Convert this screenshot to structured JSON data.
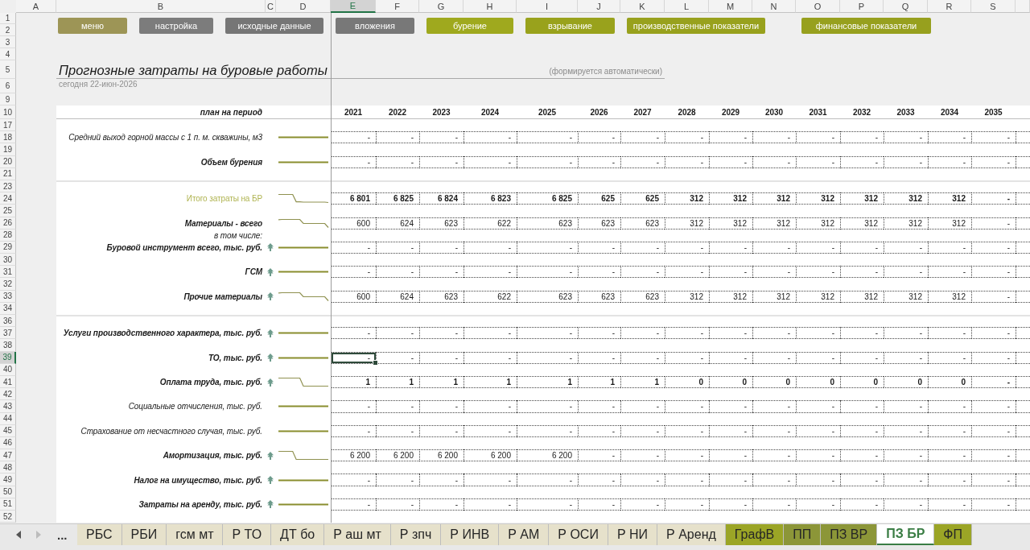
{
  "sheet": {
    "columns": [
      {
        "label": "A",
        "selected": false
      },
      {
        "label": "B",
        "selected": false
      },
      {
        "label": "C",
        "selected": false
      },
      {
        "label": "D",
        "selected": false
      },
      {
        "label": "E",
        "selected": true
      },
      {
        "label": "F",
        "selected": false
      },
      {
        "label": "G",
        "selected": false
      },
      {
        "label": "H",
        "selected": false
      },
      {
        "label": "I",
        "selected": false
      },
      {
        "label": "J",
        "selected": false
      },
      {
        "label": "K",
        "selected": false
      },
      {
        "label": "L",
        "selected": false
      },
      {
        "label": "M",
        "selected": false
      },
      {
        "label": "N",
        "selected": false
      },
      {
        "label": "O",
        "selected": false
      },
      {
        "label": "P",
        "selected": false
      },
      {
        "label": "Q",
        "selected": false
      },
      {
        "label": "R",
        "selected": false
      },
      {
        "label": "S",
        "selected": false
      }
    ],
    "rows": [
      {
        "number": "1",
        "selected": false,
        "kind": "buttons",
        "buttons": [
          {
            "label": "меню",
            "color": "#9d9556"
          },
          {
            "label": "настройка",
            "color": "#7c7c7c"
          },
          {
            "label": "исходные данные",
            "color": "#767676"
          },
          {
            "label": "вложения",
            "color": "#787878"
          },
          {
            "label": "бурение",
            "color": "#9fa91e"
          },
          {
            "label": "взрывание",
            "color": "#99a21c"
          },
          {
            "label": "производственные показатели",
            "color": "#98a11d"
          },
          {
            "label": "финансовые показатели",
            "color": "#97a01e"
          }
        ]
      },
      {
        "number": "2",
        "selected": false,
        "kind": "spacer"
      },
      {
        "number": "3",
        "selected": false,
        "kind": "spacer"
      },
      {
        "number": "4",
        "selected": false,
        "kind": "spacer"
      },
      {
        "number": "5",
        "selected": false,
        "kind": "title",
        "title": "Прогнозные затраты на буровые работы",
        "note": "(формируется автоматически)"
      },
      {
        "number": "6",
        "selected": false,
        "kind": "date",
        "text": "сегодня 22-июн-2026"
      },
      {
        "number": "9",
        "selected": false,
        "kind": "spacer"
      },
      {
        "number": "10",
        "selected": false,
        "kind": "header",
        "label": "план на период",
        "years": [
          "2021",
          "2022",
          "2023",
          "2024",
          "2025",
          "2026",
          "2027",
          "2028",
          "2029",
          "2030",
          "2031",
          "2032",
          "2033",
          "2034",
          "2035"
        ]
      },
      {
        "number": "17",
        "selected": false,
        "kind": "blank"
      },
      {
        "number": "18",
        "selected": false,
        "kind": "line",
        "label": "Средний выход горной массы с 1 п. м. скважины, м3",
        "bold": false,
        "italic": true,
        "accent": false,
        "arrow": false,
        "bold_values": false,
        "values": [
          "-",
          "-",
          "-",
          "-",
          "-",
          "-",
          "-",
          "-",
          "-",
          "-",
          "-",
          "-",
          "-",
          "-",
          "-"
        ]
      },
      {
        "number": "19",
        "selected": false,
        "kind": "blank"
      },
      {
        "number": "20",
        "selected": false,
        "kind": "line",
        "label": "Объем бурения",
        "bold": true,
        "italic": true,
        "accent": false,
        "arrow": false,
        "bold_values": false,
        "values": [
          "-",
          "-",
          "-",
          "-",
          "-",
          "-",
          "-",
          "-",
          "-",
          "-",
          "-",
          "-",
          "-",
          "-",
          "-"
        ]
      },
      {
        "number": "21",
        "selected": false,
        "kind": "blank"
      },
      {
        "number": "23",
        "selected": false,
        "kind": "section"
      },
      {
        "number": "24",
        "selected": false,
        "kind": "line",
        "label": "Итого затраты на БР",
        "bold": false,
        "italic": false,
        "accent": true,
        "arrow": false,
        "bold_values": true,
        "values": [
          "6 801",
          "6 825",
          "6 824",
          "6 823",
          "6 825",
          "625",
          "625",
          "312",
          "312",
          "312",
          "312",
          "312",
          "312",
          "312",
          "-"
        ]
      },
      {
        "number": "25",
        "selected": false,
        "kind": "blank"
      },
      {
        "number": "26",
        "selected": false,
        "kind": "line",
        "label": "Материалы - всего",
        "bold": true,
        "italic": true,
        "accent": false,
        "arrow": false,
        "bold_values": false,
        "values": [
          "600",
          "624",
          "623",
          "622",
          "623",
          "623",
          "623",
          "312",
          "312",
          "312",
          "312",
          "312",
          "312",
          "312",
          "-"
        ]
      },
      {
        "number": "28",
        "selected": false,
        "kind": "note",
        "label": "в том числе:",
        "bold": false,
        "italic": true,
        "accent": false
      },
      {
        "number": "29",
        "selected": false,
        "kind": "line",
        "label": "Буровой инструмент всего, тыс. руб.",
        "bold": true,
        "italic": true,
        "accent": false,
        "arrow": true,
        "bold_values": false,
        "values": [
          "-",
          "-",
          "-",
          "-",
          "-",
          "-",
          "-",
          "-",
          "-",
          "-",
          "-",
          "-",
          "-",
          "-",
          "-"
        ]
      },
      {
        "number": "30",
        "selected": false,
        "kind": "blank"
      },
      {
        "number": "31",
        "selected": false,
        "kind": "line",
        "label": "ГСМ",
        "bold": true,
        "italic": true,
        "accent": false,
        "arrow": true,
        "bold_values": false,
        "values": [
          "-",
          "-",
          "-",
          "-",
          "-",
          "-",
          "-",
          "-",
          "-",
          "-",
          "-",
          "-",
          "-",
          "-",
          "-"
        ]
      },
      {
        "number": "32",
        "selected": false,
        "kind": "blank"
      },
      {
        "number": "33",
        "selected": false,
        "kind": "line",
        "label": "Прочие материалы",
        "bold": true,
        "italic": true,
        "accent": false,
        "arrow": true,
        "bold_values": false,
        "values": [
          "600",
          "624",
          "623",
          "622",
          "623",
          "623",
          "623",
          "312",
          "312",
          "312",
          "312",
          "312",
          "312",
          "312",
          "-"
        ]
      },
      {
        "number": "34",
        "selected": false,
        "kind": "blank"
      },
      {
        "number": "36",
        "selected": false,
        "kind": "section"
      },
      {
        "number": "37",
        "selected": false,
        "kind": "line",
        "label": "Услуги производственного характера, тыс. руб.",
        "bold": true,
        "italic": true,
        "accent": false,
        "arrow": true,
        "bold_values": false,
        "values": [
          "-",
          "-",
          "-",
          "-",
          "-",
          "-",
          "-",
          "-",
          "-",
          "-",
          "-",
          "-",
          "-",
          "-",
          "-"
        ]
      },
      {
        "number": "38",
        "selected": false,
        "kind": "blank"
      },
      {
        "number": "39",
        "selected": true,
        "kind": "line",
        "label": "ТО, тыс. руб.",
        "bold": true,
        "italic": true,
        "accent": false,
        "arrow": true,
        "bold_values": false,
        "values": [
          "-",
          "-",
          "-",
          "-",
          "-",
          "-",
          "-",
          "-",
          "-",
          "-",
          "-",
          "-",
          "-",
          "-",
          "-"
        ]
      },
      {
        "number": "40",
        "selected": false,
        "kind": "blank"
      },
      {
        "number": "41",
        "selected": false,
        "kind": "line",
        "label": "Оплата труда, тыс. руб.",
        "bold": true,
        "italic": true,
        "accent": false,
        "arrow": true,
        "bold_values": true,
        "values": [
          "1",
          "1",
          "1",
          "1",
          "1",
          "1",
          "1",
          "0",
          "0",
          "0",
          "0",
          "0",
          "0",
          "0",
          "-"
        ]
      },
      {
        "number": "42",
        "selected": false,
        "kind": "blank"
      },
      {
        "number": "43",
        "selected": false,
        "kind": "line",
        "label": "Социальные отчисления, тыс. руб.",
        "bold": false,
        "italic": true,
        "accent": false,
        "arrow": false,
        "bold_values": false,
        "values": [
          "-",
          "-",
          "-",
          "-",
          "-",
          "-",
          "-",
          "-",
          "-",
          "-",
          "-",
          "-",
          "-",
          "-",
          "-"
        ]
      },
      {
        "number": "44",
        "selected": false,
        "kind": "blank"
      },
      {
        "number": "45",
        "selected": false,
        "kind": "line",
        "label": "Страхование от несчастного случая, тыс. руб.",
        "bold": false,
        "italic": true,
        "accent": false,
        "arrow": false,
        "bold_values": false,
        "values": [
          "-",
          "-",
          "-",
          "-",
          "-",
          "-",
          "-",
          "-",
          "-",
          "-",
          "-",
          "-",
          "-",
          "-",
          "-"
        ]
      },
      {
        "number": "46",
        "selected": false,
        "kind": "blank"
      },
      {
        "number": "47",
        "selected": false,
        "kind": "line",
        "label": "Амортизация, тыс. руб.",
        "bold": true,
        "italic": true,
        "accent": false,
        "arrow": true,
        "bold_values": false,
        "values": [
          "6 200",
          "6 200",
          "6 200",
          "6 200",
          "6 200",
          "-",
          "-",
          "-",
          "-",
          "-",
          "-",
          "-",
          "-",
          "-",
          "-"
        ]
      },
      {
        "number": "48",
        "selected": false,
        "kind": "blank"
      },
      {
        "number": "49",
        "selected": false,
        "kind": "line",
        "label": "Налог на имущество, тыс. руб.",
        "bold": true,
        "italic": true,
        "accent": false,
        "arrow": true,
        "bold_values": false,
        "values": [
          "-",
          "-",
          "-",
          "-",
          "-",
          "-",
          "-",
          "-",
          "-",
          "-",
          "-",
          "-",
          "-",
          "-",
          "-"
        ]
      },
      {
        "number": "50",
        "selected": false,
        "kind": "blank"
      },
      {
        "number": "51",
        "selected": false,
        "kind": "line",
        "label": "Затраты на аренду, тыс. руб.",
        "bold": true,
        "italic": true,
        "accent": false,
        "arrow": true,
        "bold_values": false,
        "values": [
          "-",
          "-",
          "-",
          "-",
          "-",
          "-",
          "-",
          "-",
          "-",
          "-",
          "-",
          "-",
          "-",
          "-",
          "-"
        ]
      },
      {
        "number": "52",
        "selected": false,
        "kind": "blank"
      }
    ]
  },
  "sheet_tabs": {
    "scroll_buttons": [
      {
        "kind": "left",
        "disabled": false
      },
      {
        "kind": "right",
        "disabled": true
      }
    ],
    "overflow": "...",
    "tabs": [
      {
        "label": "РБС",
        "color": "#e6e1cb",
        "selected": false
      },
      {
        "label": "РБИ",
        "color": "#e6e1cb",
        "selected": false
      },
      {
        "label": "гсм мт",
        "color": "#e6e1cb",
        "selected": false
      },
      {
        "label": "Р ТО",
        "color": "#e6e1cb",
        "selected": false
      },
      {
        "label": "ДТ бо",
        "color": "#e6e1cb",
        "selected": false
      },
      {
        "label": "Р аш мт",
        "color": "#e6e1cb",
        "selected": false
      },
      {
        "label": "Р зпч",
        "color": "#e6e1cb",
        "selected": false
      },
      {
        "label": "Р ИНВ",
        "color": "#e6e1cb",
        "selected": false
      },
      {
        "label": "Р АМ",
        "color": "#e6e1cb",
        "selected": false
      },
      {
        "label": "Р ОСИ",
        "color": "#e6e1cb",
        "selected": false
      },
      {
        "label": "Р НИ",
        "color": "#e6e1cb",
        "selected": false
      },
      {
        "label": "Р Аренд",
        "color": "#e6e1cb",
        "selected": false
      },
      {
        "label": "ГрафВ",
        "color": "#9ba526",
        "selected": false
      },
      {
        "label": "ПП",
        "color": "#8c9638",
        "selected": false
      },
      {
        "label": "ПЗ ВР",
        "color": "#8c9638",
        "selected": false
      },
      {
        "label": "ПЗ БР",
        "color": "#3a7d44",
        "selected": true
      },
      {
        "label": "ФП",
        "color": "#9ba526",
        "selected": false
      }
    ]
  }
}
